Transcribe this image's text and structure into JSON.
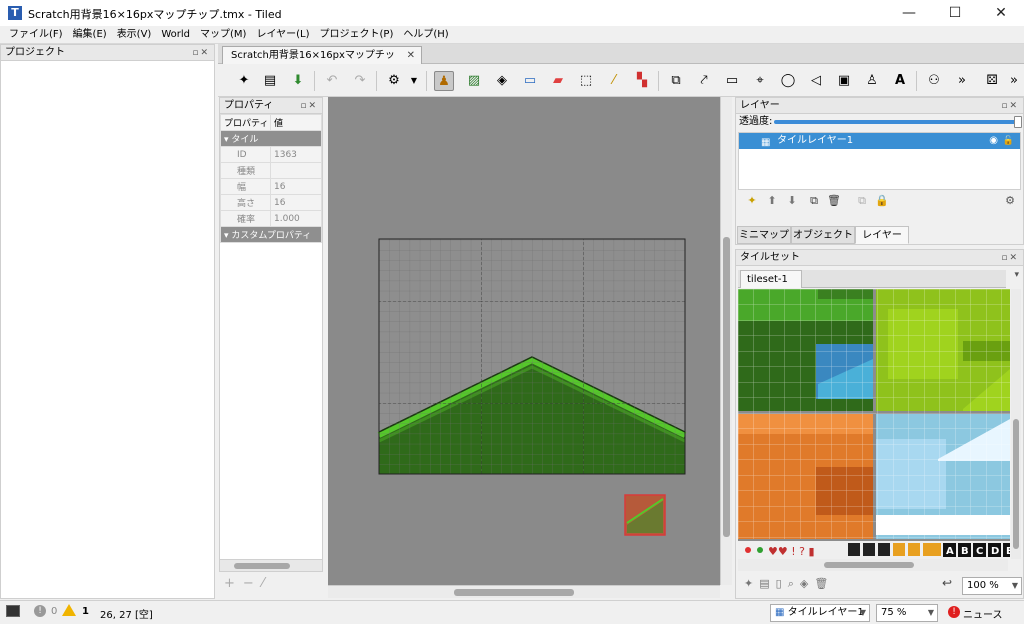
{
  "window": {
    "title": "Scratch用背景16×16pxマップチップ.tmx - Tiled",
    "minimize": "—",
    "maximize": "☐",
    "close": "✕"
  },
  "menu": [
    "ファイル(F)",
    "編集(E)",
    "表示(V)",
    "World",
    "マップ(M)",
    "レイヤー(L)",
    "プロジェクト(P)",
    "ヘルプ(H)"
  ],
  "project_panel": {
    "title": "プロジェクト"
  },
  "document_tab": {
    "label": "Scratch用背景16×16pxマップチップ.tmx"
  },
  "properties_panel": {
    "title": "プロパティ",
    "columns": [
      "プロパティ",
      "値"
    ],
    "group_tile": "タイル",
    "rows": [
      {
        "name": "ID",
        "value": "1363"
      },
      {
        "name": "種類",
        "value": ""
      },
      {
        "name": "幅",
        "value": "16"
      },
      {
        "name": "高さ",
        "value": "16"
      },
      {
        "name": "確率",
        "value": "1.000"
      }
    ],
    "group_custom": "カスタムプロパティ"
  },
  "layers_panel": {
    "title": "レイヤー",
    "opacity_label": "透過度:",
    "opacity_fraction": 1.0,
    "layer_name": "タイルレイヤー1"
  },
  "dock_tabs": [
    "ミニマップ",
    "オブジェクト",
    "レイヤー"
  ],
  "tileset_panel": {
    "title": "タイルセット",
    "tab": "tileset-1",
    "zoom": "100 %",
    "letters": [
      "A",
      "B",
      "C",
      "D",
      "E"
    ]
  },
  "status": {
    "errors": "0",
    "warnings": "1",
    "position": "26, 27 [空]",
    "layer_combo": "タイルレイヤー1",
    "zoom_combo": "75 %",
    "news": "ニュース"
  },
  "colors": {
    "accent": "#3a8fd4",
    "grass_light": "#55c82a",
    "grass_dark": "#2f6a1a",
    "canvas_bg": "#8a8a8a",
    "selection_red": "#d83a3a"
  }
}
